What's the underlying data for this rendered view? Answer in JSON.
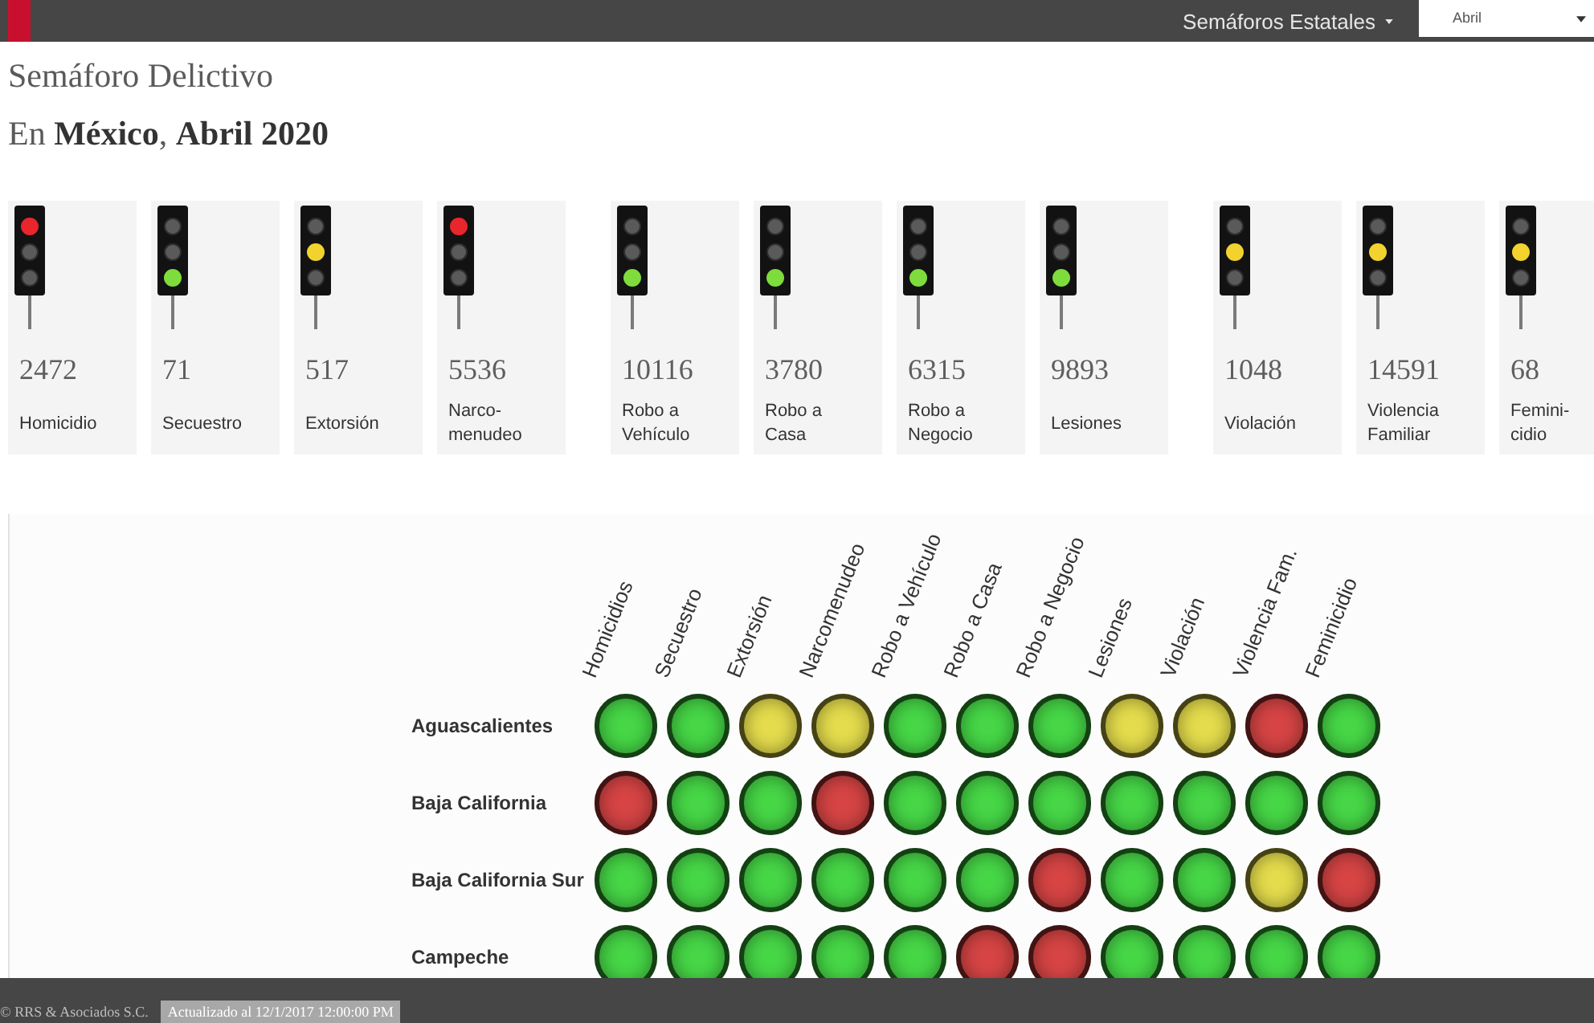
{
  "top_bar": {
    "menu_label": "Semáforos Estatales",
    "month_select": {
      "value": "Abril"
    }
  },
  "heading": {
    "title": "Semáforo Delictivo",
    "subtitle": "En **México**, **Abril 2020**"
  },
  "card_groups": [
    {
      "cards": [
        {
          "count": "2472",
          "label": "Homicidio",
          "color": "#e8262b"
        },
        {
          "count": "71",
          "label": "Secuestro",
          "color": "#7edc3c"
        },
        {
          "count": "517",
          "label": "Extorsión",
          "color": "#f2d22e"
        },
        {
          "count": "5536",
          "label": "Narco-menudeo",
          "color": "#e8262b"
        }
      ]
    },
    {
      "cards": [
        {
          "count": "10116",
          "label": "Robo a Vehículo",
          "color": "#7edc3c"
        },
        {
          "count": "3780",
          "label": "Robo a Casa",
          "color": "#7edc3c"
        },
        {
          "count": "6315",
          "label": "Robo a Negocio",
          "color": "#7edc3c"
        },
        {
          "count": "9893",
          "label": "Lesiones",
          "color": "#7edc3c"
        }
      ]
    },
    {
      "cards": [
        {
          "count": "1048",
          "label": "Violación",
          "color": "#f2d22e"
        },
        {
          "count": "14591",
          "label": "Violencia Familiar",
          "color": "#f2d22e"
        },
        {
          "count": "68",
          "label": "Femini-cidio",
          "color": "#f2d22e"
        }
      ]
    }
  ],
  "grid": {
    "columns": [
      "Homicidios",
      "Secuestro",
      "Extorsión",
      "Narcomenudeo",
      "Robo a Vehículo",
      "Robo a Casa",
      "Robo a Negocio",
      "Lesiones",
      "Violación",
      "Violencia Fam.",
      "Feminicidio"
    ],
    "rows": [
      {
        "state": "Aguascalientes",
        "lights": [
          {
            "color": "#46d646"
          },
          {
            "color": "#46d646"
          },
          {
            "color": "#e4dc4c"
          },
          {
            "color": "#e4dc4c"
          },
          {
            "color": "#46d646"
          },
          {
            "color": "#46d646"
          },
          {
            "color": "#46d646"
          },
          {
            "color": "#e4dc4c"
          },
          {
            "color": "#e4dc4c"
          },
          {
            "color": "#d64444"
          },
          {
            "color": "#46d646"
          }
        ]
      },
      {
        "state": "Baja California",
        "lights": [
          {
            "color": "#d64444"
          },
          {
            "color": "#46d646"
          },
          {
            "color": "#46d646"
          },
          {
            "color": "#d64444"
          },
          {
            "color": "#46d646"
          },
          {
            "color": "#46d646"
          },
          {
            "color": "#46d646"
          },
          {
            "color": "#46d646"
          },
          {
            "color": "#46d646"
          },
          {
            "color": "#46d646"
          },
          {
            "color": "#46d646"
          }
        ]
      },
      {
        "state": "Baja California Sur",
        "lights": [
          {
            "color": "#46d646"
          },
          {
            "color": "#46d646"
          },
          {
            "color": "#46d646"
          },
          {
            "color": "#46d646"
          },
          {
            "color": "#46d646"
          },
          {
            "color": "#46d646"
          },
          {
            "color": "#d64444"
          },
          {
            "color": "#46d646"
          },
          {
            "color": "#46d646"
          },
          {
            "color": "#e4dc4c"
          },
          {
            "color": "#d64444"
          }
        ]
      },
      {
        "state": "Campeche",
        "lights": [
          {
            "color": "#46d646"
          },
          {
            "color": "#46d646"
          },
          {
            "color": "#46d646"
          },
          {
            "color": "#46d646"
          },
          {
            "color": "#46d646"
          },
          {
            "color": "#d64444"
          },
          {
            "color": "#d64444"
          },
          {
            "color": "#46d646"
          },
          {
            "color": "#46d646"
          },
          {
            "color": "#46d646"
          },
          {
            "color": "#46d646"
          }
        ]
      }
    ]
  },
  "footer": {
    "copyright": "© RRS & Asociados S.C.",
    "updated": "Actualizado al 12/1/2017 12:00:00 PM"
  }
}
